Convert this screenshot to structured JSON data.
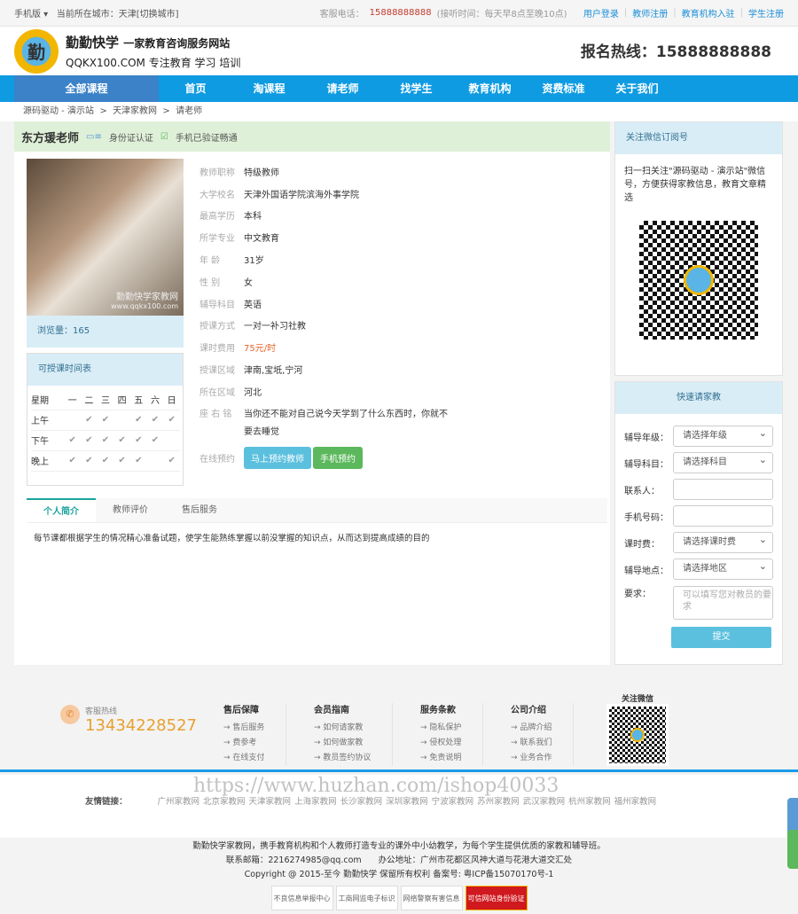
{
  "topbar": {
    "mobile": "手机版 ▾",
    "city_label": "当前所在城市：天津",
    "switch_city": "[切换城市]",
    "phone_label": "客服电话：",
    "phone": "15888888888",
    "hours": "(接听时间：每天早8点至晚10点)",
    "links": [
      "用户登录",
      "教师注册",
      "教育机构入驻",
      "学生注册"
    ]
  },
  "header": {
    "logo_text": "勤",
    "title": "勤勤快学",
    "subtitle": "一家教育咨询服务网站",
    "domain": "QQKX100.COM  专注教育 学习 培训",
    "hotline": "报名热线：15888888888"
  },
  "nav": [
    "全部课程",
    "首页",
    "淘课程",
    "请老师",
    "找学生",
    "教育机构",
    "资费标准",
    "关于我们"
  ],
  "breadcrumb": [
    "源码驱动 - 演示站",
    "天津家教网",
    "请老师"
  ],
  "teacher": {
    "name": "东方瑗老师",
    "id_verified": "身份证认证",
    "phone_verified": "手机已验证畅通",
    "photo_watermark": "勤勤快学家教网",
    "photo_url_watermark": "www.qqkx100.com",
    "views": "浏览量：165",
    "fields": [
      {
        "k": "教师职称",
        "v": "特级教师"
      },
      {
        "k": "大学校名",
        "v": "天津外国语学院滨海外事学院"
      },
      {
        "k": "最高学历",
        "v": "本科"
      },
      {
        "k": "所学专业",
        "v": "中文教育"
      },
      {
        "k": "年 龄",
        "v": "31岁"
      },
      {
        "k": "性 别",
        "v": "女"
      },
      {
        "k": "辅导科目",
        "v": "英语"
      },
      {
        "k": "授课方式",
        "v": "一对一补习社教"
      },
      {
        "k": "课时费用",
        "v": "75元/时"
      },
      {
        "k": "授课区域",
        "v": "津南,宝坻,宁河"
      },
      {
        "k": "所在区域",
        "v": "河北"
      }
    ],
    "motto_label": "座 右 铭",
    "motto": "当你还不能对自己说今天学到了什么东西时，你就不要去睡觉",
    "booking_label": "在线预约",
    "book_button": "马上预约教师",
    "mobile_book_button": "手机预约"
  },
  "schedule": {
    "title": "可授课时间表",
    "header": [
      "星期",
      "一",
      "二",
      "三",
      "四",
      "五",
      "六",
      "日"
    ],
    "rows": [
      {
        "label": "上午",
        "days": [
          false,
          true,
          true,
          false,
          true,
          true,
          true
        ]
      },
      {
        "label": "下午",
        "days": [
          true,
          true,
          true,
          true,
          true,
          true,
          false
        ]
      },
      {
        "label": "晚上",
        "days": [
          true,
          true,
          true,
          true,
          true,
          false,
          true
        ]
      }
    ],
    "check": "✔"
  },
  "tabs": [
    "个人简介",
    "教师评价",
    "售后服务"
  ],
  "intro": "每节课都根据学生的情况精心准备试题，使学生能熟练掌握以前没掌握的知识点，从而达到提高成绩的目的",
  "wechat": {
    "title": "关注微信订阅号",
    "desc": "扫一扫关注\"源码驱动 - 演示站\"微信号，方便获得家教信息，教育文章精选"
  },
  "quick_form": {
    "title": "快速请家教",
    "fields": [
      {
        "label": "辅导年级：",
        "value": "请选择年级",
        "type": "select"
      },
      {
        "label": "辅导科目：",
        "value": "请选择科目",
        "type": "select"
      },
      {
        "label": "联系人：",
        "value": "",
        "type": "input"
      },
      {
        "label": "手机号码：",
        "value": "",
        "type": "input"
      },
      {
        "label": "课时费：",
        "value": "请选择课时费",
        "type": "select"
      },
      {
        "label": "辅导地点：",
        "value": "请选择地区",
        "type": "select"
      }
    ],
    "req_label": "要求：",
    "req_placeholder": "可以填写您对教员的要求",
    "submit": "提交"
  },
  "footer": {
    "hotline_label": "客服热线",
    "hotline": "13434228527",
    "cols": [
      {
        "title": "售后保障",
        "items": [
          "→ 售后服务",
          "→ 费参考",
          "→ 在线支付"
        ]
      },
      {
        "title": "会员指南",
        "items": [
          "→ 如何请家教",
          "→ 如何做家教",
          "→ 教员签约协议"
        ]
      },
      {
        "title": "服务条款",
        "items": [
          "→ 隐私保护",
          "→ 侵权处理",
          "→ 免责说明"
        ]
      },
      {
        "title": "公司介绍",
        "items": [
          "→ 品牌介绍",
          "→ 联系我们",
          "→ 业务合作"
        ]
      }
    ],
    "wechat_label": "关注微信",
    "watermark": "https://www.huzhan.com/ishop40033",
    "links_label": "友情链接：",
    "links": [
      "广州家教网",
      "北京家教网",
      "天津家教网",
      "上海家教网",
      "长沙家教网",
      "深圳家教网",
      "宁波家教网",
      "苏州家教网",
      "武汉家教网",
      "杭州家教网",
      "福州家教网"
    ],
    "about": "勤勤快学家教网，携手教育机构和个人教师打造专业的课外中小幼教学，为每个学生提供优质的家教和辅导班。",
    "contact": "联系邮箱：2216274985@qq.com　　办公地址：广州市花都区风神大道与花港大道交汇处",
    "copyright": "Copyright @ 2015-至今 勤勤快学 保留所有权利 备案号: 粤ICP备15070170号-1",
    "badges": [
      "不良信息举报中心",
      "工商网监电子标识",
      "网络警察有害信息",
      "可信网站身份验证"
    ]
  },
  "colors": {
    "nav": "#0e9be2",
    "accent": "#1ba39c",
    "price": "#e8652c"
  }
}
